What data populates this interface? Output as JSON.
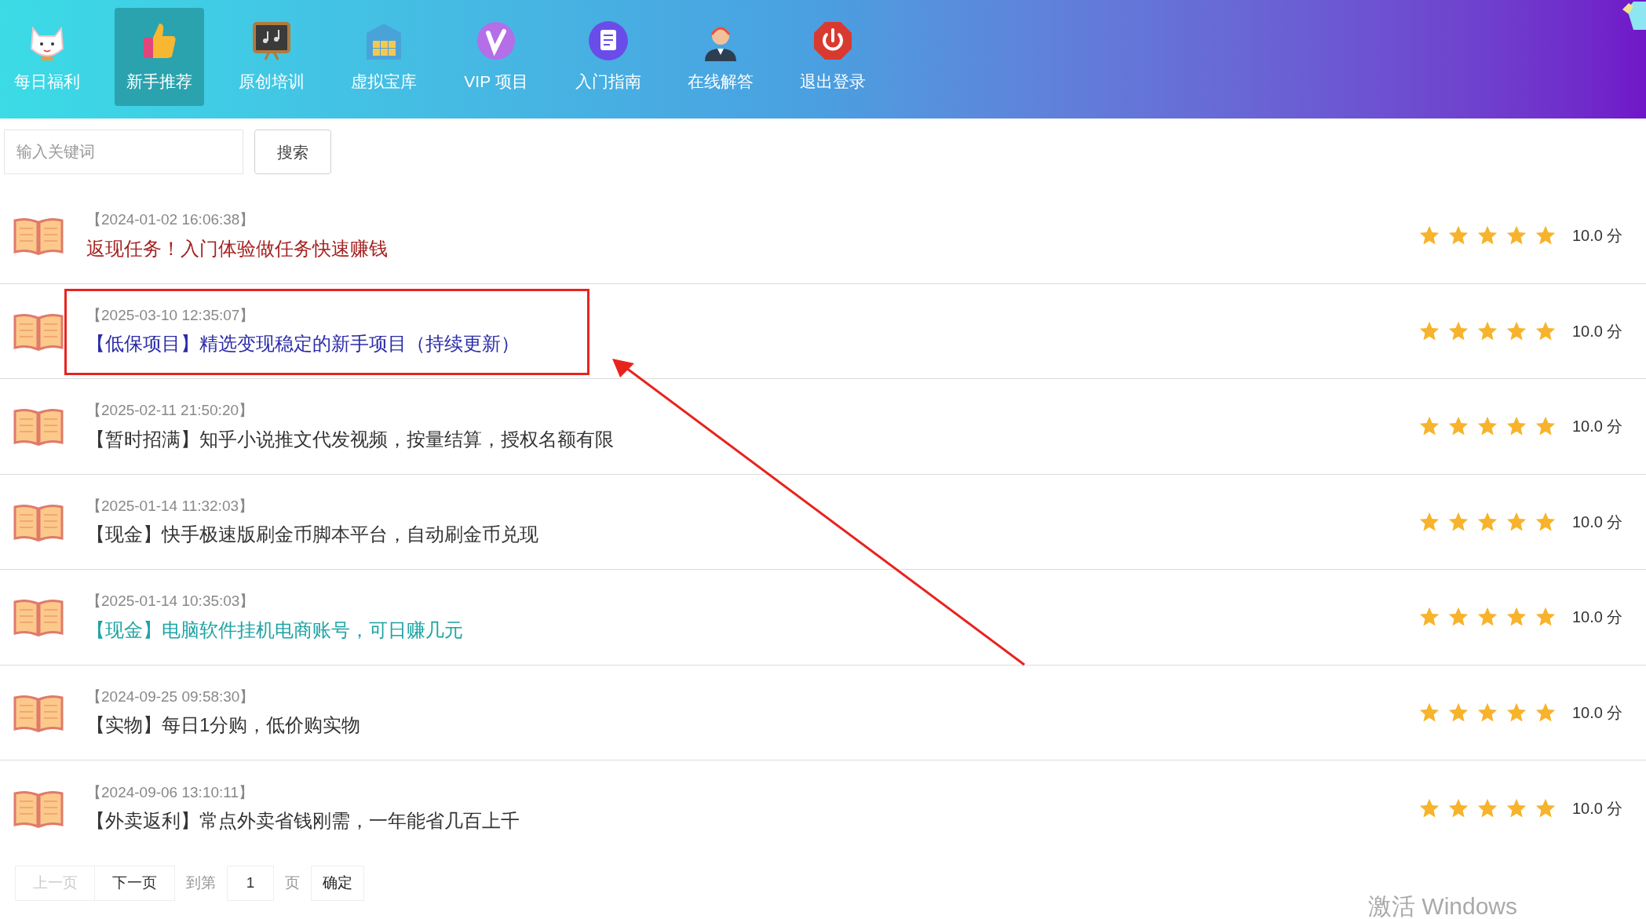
{
  "nav": [
    {
      "label": "每日福利",
      "selected": false
    },
    {
      "label": "新手推荐",
      "selected": true
    },
    {
      "label": "原创培训",
      "selected": false
    },
    {
      "label": "虚拟宝库",
      "selected": false
    },
    {
      "label": "VIP 项目",
      "selected": false
    },
    {
      "label": "入门指南",
      "selected": false
    },
    {
      "label": "在线解答",
      "selected": false
    },
    {
      "label": "退出登录",
      "selected": false
    }
  ],
  "search": {
    "placeholder": "输入关键词",
    "button": "搜索"
  },
  "articles": [
    {
      "date": "【2024-01-02 16:06:38】",
      "title": "返现任务！入门体验做任务快速赚钱",
      "color": "#a52222",
      "stars": 5,
      "score": "10.0 分"
    },
    {
      "date": "【2025-03-10 12:35:07】",
      "title": "【低保项目】精选变现稳定的新手项目（持续更新）",
      "color": "#2b2ba8",
      "stars": 5,
      "score": "10.0 分"
    },
    {
      "date": "【2025-02-11 21:50:20】",
      "title": "【暂时招满】知乎小说推文代发视频，按量结算，授权名额有限",
      "color": "#333333",
      "stars": 5,
      "score": "10.0 分"
    },
    {
      "date": "【2025-01-14 11:32:03】",
      "title": "【现金】快手极速版刷金币脚本平台，自动刷金币兑现",
      "color": "#333333",
      "stars": 5,
      "score": "10.0 分"
    },
    {
      "date": "【2025-01-14 10:35:03】",
      "title": "【现金】电脑软件挂机电商账号，可日赚几元",
      "color": "#1fa3a3",
      "stars": 5,
      "score": "10.0 分"
    },
    {
      "date": "【2024-09-25 09:58:30】",
      "title": "【实物】每日1分购，低价购实物",
      "color": "#333333",
      "stars": 5,
      "score": "10.0 分"
    },
    {
      "date": "【2024-09-06 13:10:11】",
      "title": "【外卖返利】常点外卖省钱刚需，一年能省几百上千",
      "color": "#333333",
      "stars": 5,
      "score": "10.0 分"
    }
  ],
  "pagination": {
    "prev": "上一页",
    "prev_disabled": true,
    "next": "下一页",
    "goto_label": "到第",
    "page": "1",
    "page_suffix": "页",
    "confirm": "确定"
  },
  "os_notice": "激活 Windows"
}
